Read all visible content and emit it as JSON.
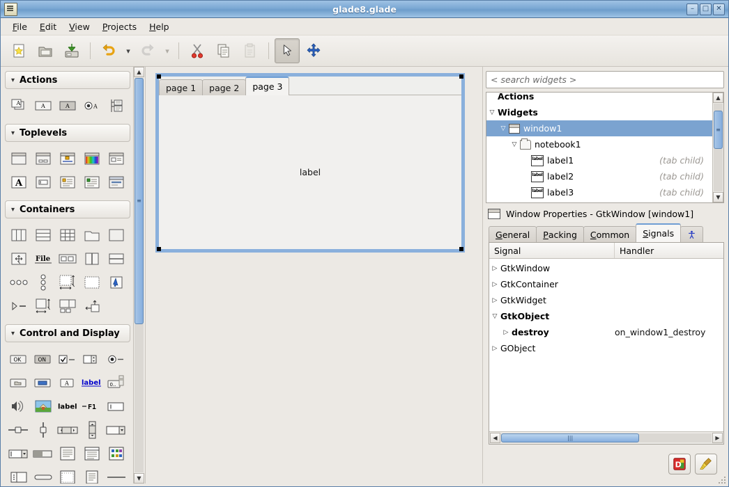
{
  "window": {
    "title": "glade8.glade",
    "icon": "glade-app-icon",
    "buttons": [
      {
        "name": "minimize",
        "glyph": "–"
      },
      {
        "name": "maximize",
        "glyph": "□"
      },
      {
        "name": "close",
        "glyph": "✕"
      }
    ]
  },
  "menubar": {
    "items": [
      {
        "mnemonic": "F",
        "rest": "ile"
      },
      {
        "mnemonic": "E",
        "rest": "dit"
      },
      {
        "mnemonic": "V",
        "rest": "iew"
      },
      {
        "mnemonic": "P",
        "rest": "rojects"
      },
      {
        "mnemonic": "H",
        "rest": "elp"
      }
    ]
  },
  "toolbar": {
    "items": [
      {
        "name": "new-icon",
        "label": "New",
        "state": "enabled"
      },
      {
        "name": "open-icon",
        "label": "Open",
        "state": "enabled"
      },
      {
        "name": "save-icon",
        "label": "Save",
        "state": "enabled"
      },
      {
        "name": "undo-icon",
        "label": "Undo",
        "state": "enabled"
      },
      {
        "name": "redo-icon",
        "label": "Redo",
        "state": "disabled"
      },
      {
        "name": "cut-icon",
        "label": "Cut",
        "state": "enabled"
      },
      {
        "name": "copy-icon",
        "label": "Copy",
        "state": "enabled"
      },
      {
        "name": "paste-icon",
        "label": "Paste",
        "state": "disabled"
      },
      {
        "name": "select-pointer-icon",
        "label": "Select",
        "state": "pressed"
      },
      {
        "name": "drag-resize-icon",
        "label": "Drag and Resize",
        "state": "enabled"
      }
    ]
  },
  "palette": {
    "groups": [
      {
        "name": "Actions",
        "expanded": true,
        "items": [
          "action-group-icon",
          "action-icon",
          "toggle-action-icon",
          "radio-action-icon",
          "recent-action-icon"
        ]
      },
      {
        "name": "Toplevels",
        "expanded": true,
        "items": [
          "window-icon",
          "dialog-icon",
          "message-dialog-icon",
          "color-selection-dialog-icon",
          "file-chooser-dialog-icon",
          "font-selection-dialog-icon",
          "input-dialog-icon",
          "about-dialog-icon",
          "assistant-icon",
          "offscreen-window-icon"
        ]
      },
      {
        "name": "Containers",
        "expanded": true,
        "items": [
          "hbox-icon",
          "vbox-icon",
          "table-icon",
          "notebook-icon",
          "frame-icon",
          "alignment-icon",
          "file-chooser-widget-icon",
          "hbutton-box-icon",
          "hpaned-icon",
          "vpaned-icon",
          "hbutton-box-small-icon",
          "vbutton-box-icon",
          "scrolled-window-icon",
          "viewport-icon",
          "event-box-icon",
          "expander-icon",
          "size-group-icon",
          "handle-box-icon",
          "toolbar-attach-icon"
        ]
      },
      {
        "name": "Control and Display",
        "expanded": true,
        "items": [
          "button-icon",
          "toggle-button-icon",
          "check-button-icon",
          "spin-button-icon",
          "radio-button-icon",
          "file-chooser-button-icon",
          "color-button-icon",
          "font-button-icon",
          "link-button-icon",
          "scale-button-icon",
          "volume-button-icon",
          "image-icon",
          "label-icon",
          "accel-label-icon",
          "entry-icon",
          "hscale-icon",
          "vscale-icon",
          "hscrollbar-icon",
          "vscrollbar-icon",
          "combo-box-icon",
          "combo-box-entry-icon",
          "progress-bar-icon",
          "text-view-icon",
          "tree-view-icon",
          "icon-view-icon",
          "list-view-icon",
          "separator-icon",
          "drawing-area-icon",
          "layout-icon",
          "hseparator-icon"
        ]
      }
    ],
    "scroll_thumb_pct": 62
  },
  "canvas": {
    "design_window": {
      "name": "window1",
      "selected": true,
      "notebook": {
        "name": "notebook1",
        "tabs": [
          {
            "label": "page 1",
            "active": false
          },
          {
            "label": "page 2",
            "active": false
          },
          {
            "label": "page 3",
            "active": true
          }
        ],
        "body_label": "label"
      }
    }
  },
  "inspector": {
    "search": {
      "placeholder": "< search widgets >",
      "value": ""
    },
    "tree": [
      {
        "label": "Actions",
        "depth": 0,
        "bold": true,
        "expander": "",
        "icon": "",
        "note": "",
        "selected": false
      },
      {
        "label": "Widgets",
        "depth": 0,
        "bold": true,
        "expander": "▽",
        "icon": "",
        "note": "",
        "selected": false
      },
      {
        "label": "window1",
        "depth": 1,
        "bold": false,
        "expander": "▽",
        "icon": "window-icon",
        "note": "",
        "selected": true
      },
      {
        "label": "notebook1",
        "depth": 2,
        "bold": false,
        "expander": "▽",
        "icon": "notebook-icon",
        "note": "",
        "selected": false
      },
      {
        "label": "label1",
        "depth": 3,
        "bold": false,
        "expander": "",
        "icon": "label-icon",
        "note": "(tab child)",
        "selected": false
      },
      {
        "label": "label2",
        "depth": 3,
        "bold": false,
        "expander": "",
        "icon": "label-icon",
        "note": "(tab child)",
        "selected": false
      },
      {
        "label": "label3",
        "depth": 3,
        "bold": false,
        "expander": "",
        "icon": "label-icon",
        "note": "(tab child)",
        "selected": false
      }
    ],
    "scroll_thumb_top_pct": 10,
    "scroll_thumb_height_pct": 42
  },
  "properties": {
    "header": "Window Properties - GtkWindow [window1]",
    "tabs": [
      {
        "mnemonic": "G",
        "rest": "eneral",
        "active": false
      },
      {
        "mnemonic": "P",
        "rest": "acking",
        "active": false
      },
      {
        "mnemonic": "C",
        "rest": "ommon",
        "active": false
      },
      {
        "mnemonic": "S",
        "rest": "ignals",
        "active": true
      },
      {
        "mnemonic": "",
        "rest": "",
        "active": false,
        "icon": "accessibility-icon"
      }
    ],
    "signals": {
      "columns": [
        "Signal",
        "Handler"
      ],
      "rows": [
        {
          "signal": "GtkWindow",
          "handler": "",
          "depth": 0,
          "expander": "▷",
          "bold": false
        },
        {
          "signal": "GtkContainer",
          "handler": "",
          "depth": 0,
          "expander": "▷",
          "bold": false
        },
        {
          "signal": "GtkWidget",
          "handler": "",
          "depth": 0,
          "expander": "▷",
          "bold": false
        },
        {
          "signal": "GtkObject",
          "handler": "",
          "depth": 0,
          "expander": "▽",
          "bold": true
        },
        {
          "signal": "destroy",
          "handler": "on_window1_destroy",
          "depth": 1,
          "expander": "▷",
          "bold": true
        },
        {
          "signal": "GObject",
          "handler": "",
          "depth": 0,
          "expander": "▷",
          "bold": false
        }
      ],
      "hscroll_thumb_pct": 65,
      "hscroll_grip": "|||"
    },
    "footer_buttons": [
      {
        "name": "documentation-button",
        "icon": "devhelp-icon"
      },
      {
        "name": "clear-signal-button",
        "icon": "broom-icon"
      }
    ]
  },
  "colors": {
    "titlebar": "#7ba8d4",
    "selection": "#7ba3d0",
    "scrollbar_thumb": "#86aede",
    "tab_accent": "#6f9ed4",
    "design_border": "#8ab0dc",
    "link": "#0000cc"
  }
}
